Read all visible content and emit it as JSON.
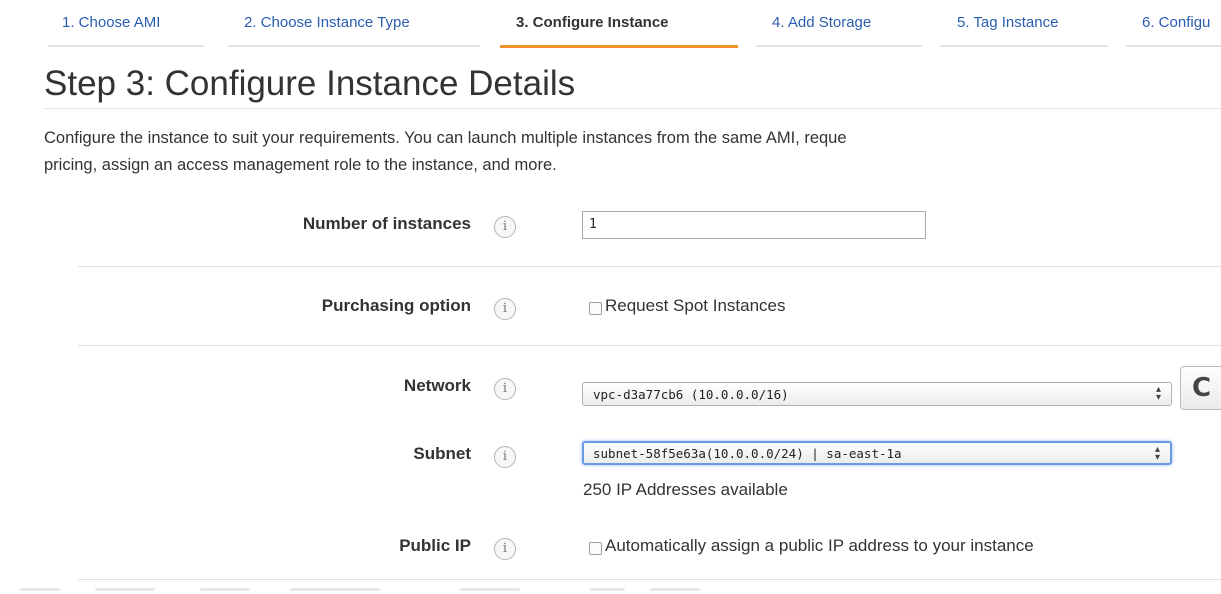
{
  "wizard": {
    "tabs": [
      {
        "label": "1. Choose AMI"
      },
      {
        "label": "2. Choose Instance Type"
      },
      {
        "label": "3. Configure Instance"
      },
      {
        "label": "4. Add Storage"
      },
      {
        "label": "5. Tag Instance"
      },
      {
        "label": "6. Configu"
      }
    ],
    "active_tab": 2
  },
  "page": {
    "title": "Step 3: Configure Instance Details",
    "intro_line1": "Configure the instance to suit your requirements. You can launch multiple instances from the same AMI, reque",
    "intro_line2": "pricing, assign an access management role to the instance, and more."
  },
  "form": {
    "number_of_instances": {
      "label": "Number of instances",
      "value": "1"
    },
    "purchasing_option": {
      "label": "Purchasing option",
      "checkbox_label": "Request Spot Instances",
      "checked": false
    },
    "network": {
      "label": "Network",
      "selected": "vpc-d3a77cb6 (10.0.0.0/16)"
    },
    "subnet": {
      "label": "Subnet",
      "selected": "subnet-58f5e63a(10.0.0.0/24) | sa-east-1a",
      "note": "250 IP Addresses available"
    },
    "public_ip": {
      "label": "Public IP",
      "checkbox_label": "Automatically assign a public IP address to your instance",
      "checked": false
    }
  },
  "icons": {
    "info": "info-icon",
    "refresh": "refresh-icon",
    "select_arrows": "updown-arrows-icon"
  },
  "colors": {
    "link": "#2a5db0",
    "active_tab_underline": "#f0932b",
    "focus_ring": "#6a9be8"
  }
}
